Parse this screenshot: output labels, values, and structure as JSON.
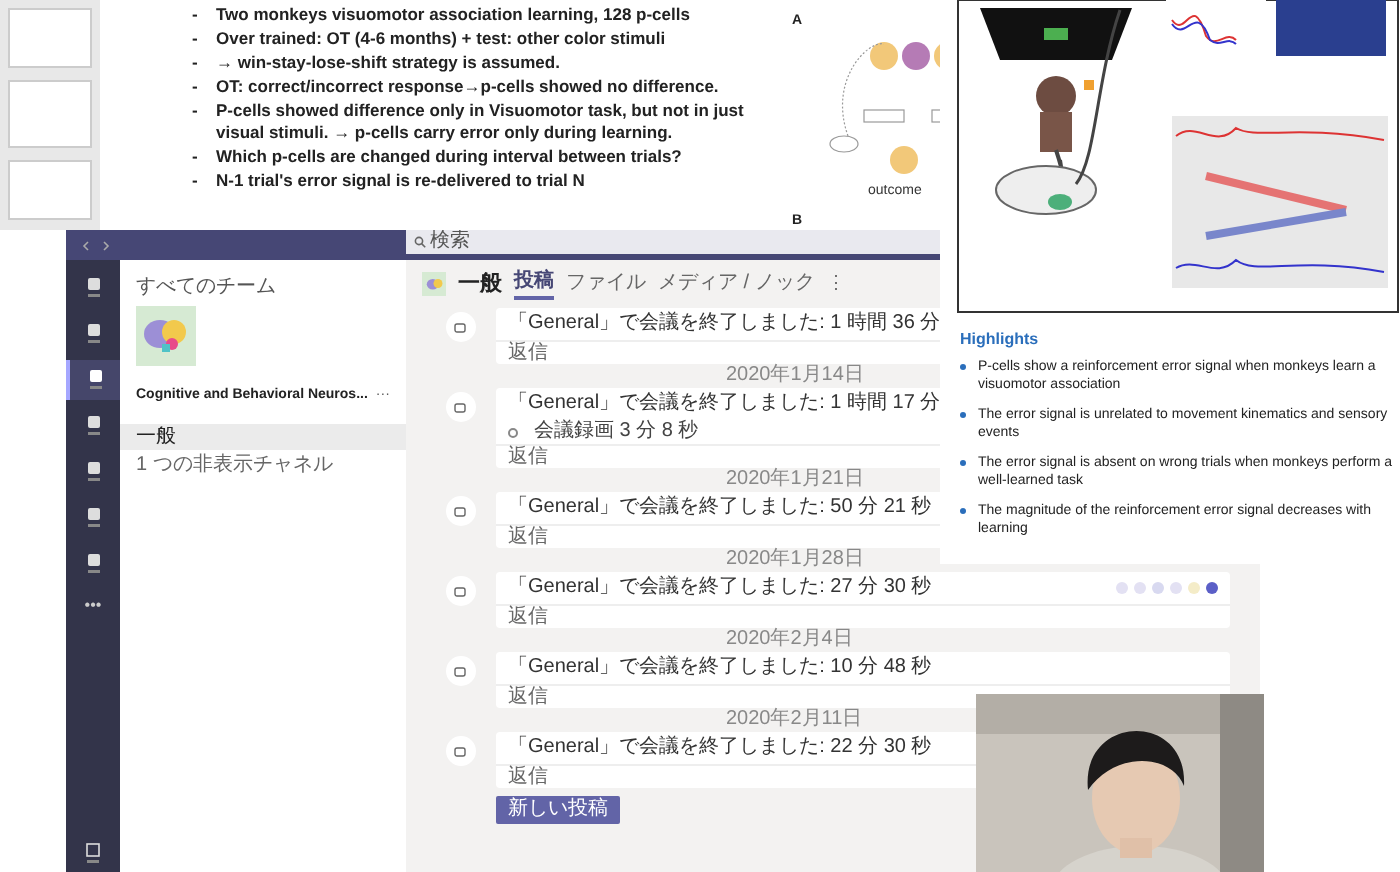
{
  "slide": {
    "marker": "-",
    "bullets": [
      {
        "text": "Two monkeys visuomotor association learning, 128 p-cells"
      },
      {
        "text": "Over trained: OT (4-6 months) + test: other color stimuli"
      },
      {
        "text": "→ win-stay-lose-shift strategy is assumed."
      },
      {
        "text": "OT: correct/incorrect response→p-cells showed no difference."
      },
      {
        "text": "P-cells showed difference only in Visuomotor task, but not in just visual stimuli. → p-cells carry error only during learning."
      },
      {
        "text": "Which p-cells are changed during interval between trials?"
      },
      {
        "text": "N-1 trial's error signal is re-delivered to trial N"
      }
    ],
    "diagram": {
      "panel_a": "A",
      "panel_b": "B",
      "node_label": "outcome"
    }
  },
  "teams": {
    "search": {
      "placeholder": "検索"
    },
    "rail": [
      {
        "selected": false
      },
      {
        "selected": false
      },
      {
        "selected": true
      },
      {
        "selected": false
      },
      {
        "selected": false
      },
      {
        "selected": false
      },
      {
        "selected": false
      }
    ],
    "more": "•••",
    "back_link": "すべてのチーム",
    "team_name": "Cognitive and Behavioral Neuros...",
    "team_menu": "···",
    "channels": [
      {
        "name": "一般",
        "selected": true
      }
    ],
    "hidden_channels": "1 つの非表示チャネル",
    "channel_header": {
      "name": "一般",
      "tabs": [
        {
          "label": "投稿",
          "selected": true
        },
        {
          "label": "ファイル",
          "selected": false
        },
        {
          "label": "メディア / ノック",
          "selected": false
        }
      ],
      "more": "⋮"
    },
    "feed": [
      {
        "kind": "post",
        "text": "「General」で会議を終了しました: 1 時間 36 分",
        "reply": "返信"
      },
      {
        "kind": "date",
        "text": "2020年1月14日"
      },
      {
        "kind": "post",
        "text": "「General」で会議を終了しました: 1 時間 17 分",
        "attachment": "会議録画 3 分 8 秒",
        "reply": "返信"
      },
      {
        "kind": "date",
        "text": "2020年1月21日"
      },
      {
        "kind": "post",
        "text": "「General」で会議を終了しました: 50 分 21 秒",
        "reply": "返信"
      },
      {
        "kind": "date",
        "text": "2020年1月28日"
      },
      {
        "kind": "post",
        "text": "「General」で会議を終了しました: 27 分 30 秒",
        "reply": "返信",
        "reactions": [
          {
            "color": "#e3e1f3"
          },
          {
            "color": "#e3e1f3"
          },
          {
            "color": "#d8d9f0"
          },
          {
            "color": "#e3e1f3"
          },
          {
            "color": "#f4ecc8"
          },
          {
            "color": "#5b5fc7"
          }
        ]
      },
      {
        "kind": "date",
        "text": "2020年2月4日"
      },
      {
        "kind": "post",
        "text": "「General」で会議を終了しました: 10 分 48 秒",
        "reply": "返信"
      },
      {
        "kind": "date",
        "text": "2020年2月11日"
      },
      {
        "kind": "post",
        "text": "「General」で会議を終了しました: 22 分 30 秒",
        "reply": "返信"
      }
    ],
    "new_post_button": "新しい投稿"
  },
  "highlights": {
    "title": "Highlights",
    "items": [
      "P-cells show a reinforcement error signal when monkeys learn a visuomotor association",
      "The error signal is unrelated to movement kinematics and sensory events",
      "The error signal is absent on wrong trials when monkeys perform a well-learned task",
      "The magnitude of the reinforcement error signal decreases with learning"
    ]
  }
}
